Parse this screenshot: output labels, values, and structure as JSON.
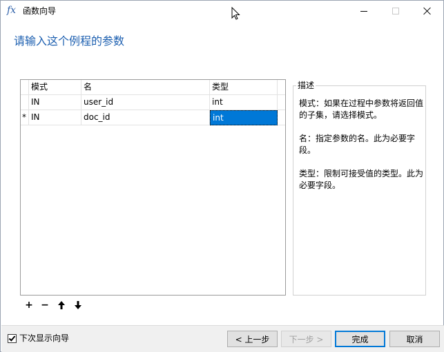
{
  "window": {
    "title": "函数向导",
    "icon": "fx-icon"
  },
  "heading": "请输入这个例程的参数",
  "grid": {
    "columns": [
      "模式",
      "名",
      "类型"
    ],
    "rows": [
      {
        "marker": "",
        "mode": "IN",
        "name": "user_id",
        "type": "int"
      },
      {
        "marker": "*",
        "mode": "IN",
        "name": "doc_id",
        "type": "int"
      }
    ],
    "selected": {
      "row": 1,
      "column": "type"
    }
  },
  "description": {
    "legend": "描述",
    "paragraphs": [
      "模式：如果在过程中参数将返回值的子集，请选择模式。",
      "名：指定参数的名。此为必要字段。",
      "类型：限制可接受值的类型。此为必要字段。"
    ]
  },
  "toolbar": {
    "add": "+",
    "remove": "−",
    "up": "🡑",
    "down": "🡓"
  },
  "footer": {
    "show_wizard_label": "下次显示向导",
    "show_wizard_checked": true,
    "prev_label": "< 上一步",
    "next_label": "下一步 >",
    "finish_label": "完成",
    "cancel_label": "取消"
  },
  "colors": {
    "accent": "#0078d7",
    "heading": "#1c5fb0"
  }
}
